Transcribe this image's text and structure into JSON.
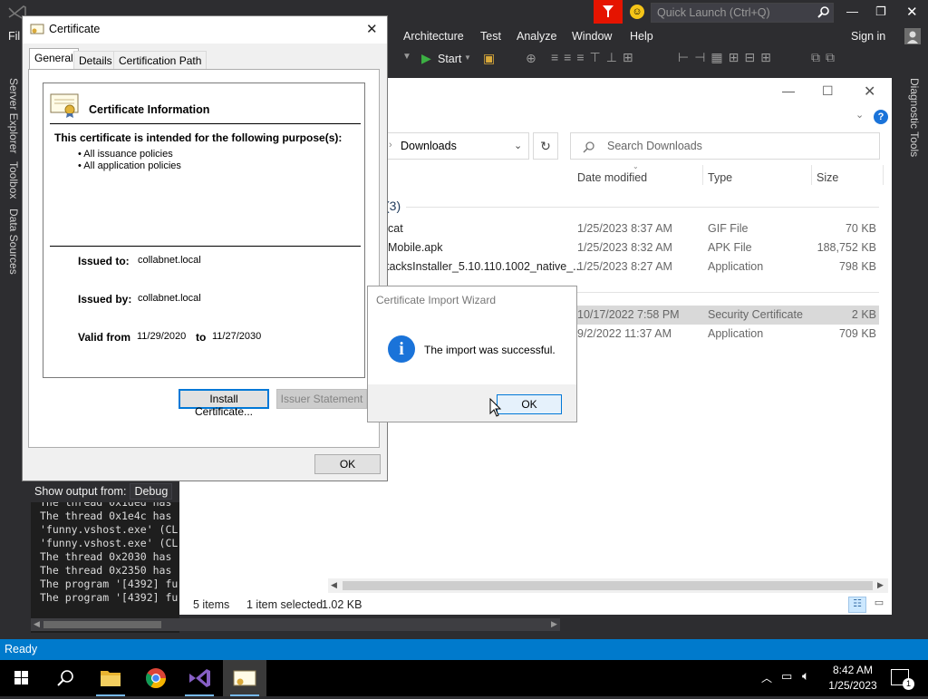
{
  "vs": {
    "menu": [
      "Fil",
      "Architecture",
      "Test",
      "Analyze",
      "Window",
      "Help"
    ],
    "sign_in": "Sign in",
    "quick_launch_placeholder": "Quick Launch (Ctrl+Q)",
    "start_label": "Start",
    "side_tabs": [
      "Server Explorer",
      "Toolbox",
      "Data Sources"
    ],
    "right_tab": "Diagnostic Tools",
    "status": "Ready",
    "output": {
      "show_output_from": "Show output from:",
      "source": "Debug",
      "lines": [
        "The thread 0x1ded has",
        "The thread 0x1e4c has",
        "'funny.vshost.exe' (CL",
        "'funny.vshost.exe' (CL",
        "The thread 0x2030 has",
        "The thread 0x2350 has",
        "The program '[4392] fu",
        "The program '[4392] fu"
      ]
    }
  },
  "explorer": {
    "address": "Downloads",
    "search_placeholder": "Search Downloads",
    "columns": [
      "Date modified",
      "Type",
      "Size"
    ],
    "group_label": "(3)",
    "rows": [
      {
        "name": "cat",
        "date": "1/25/2023 8:37 AM",
        "type": "GIF File",
        "size": "70 KB"
      },
      {
        "name": "Mobile.apk",
        "date": "1/25/2023 8:32 AM",
        "type": "APK File",
        "size": "188,752 KB"
      },
      {
        "name": "tacksInstaller_5.10.110.1002_native_...",
        "date": "1/25/2023 8:27 AM",
        "type": "Application",
        "size": "798 KB"
      },
      {
        "name": "",
        "date": "10/17/2022 7:58 PM",
        "type": "Security Certificate",
        "size": "2 KB"
      },
      {
        "name": "",
        "date": "9/2/2022 11:37 AM",
        "type": "Application",
        "size": "709 KB"
      }
    ],
    "status": {
      "items": "5 items",
      "selected": "1 item selected",
      "size": "1.02 KB"
    }
  },
  "certificate": {
    "title": "Certificate",
    "tabs": [
      "General",
      "Details",
      "Certification Path"
    ],
    "info_heading": "Certificate Information",
    "purpose_heading": "This certificate is intended for the following purpose(s):",
    "purposes": [
      "• All issuance policies",
      "• All application policies"
    ],
    "issued_to_label": "Issued to:",
    "issued_to": "collabnet.local",
    "issued_by_label": "Issued by:",
    "issued_by": "collabnet.local",
    "valid_from_label": "Valid from",
    "valid_from": "11/29/2020",
    "to_label": "to",
    "valid_to": "11/27/2030",
    "install_button": "Install Certificate...",
    "issuer_button": "Issuer Statement",
    "ok_button": "OK"
  },
  "wizard": {
    "title": "Certificate Import Wizard",
    "message": "The import was successful.",
    "ok_button": "OK"
  },
  "taskbar": {
    "time": "8:42 AM",
    "date": "1/25/2023",
    "notification_count": "1"
  },
  "colors": {
    "vs_accent": "#007acc",
    "selection": "#cce8ff",
    "info_blue": "#1a73d9"
  }
}
